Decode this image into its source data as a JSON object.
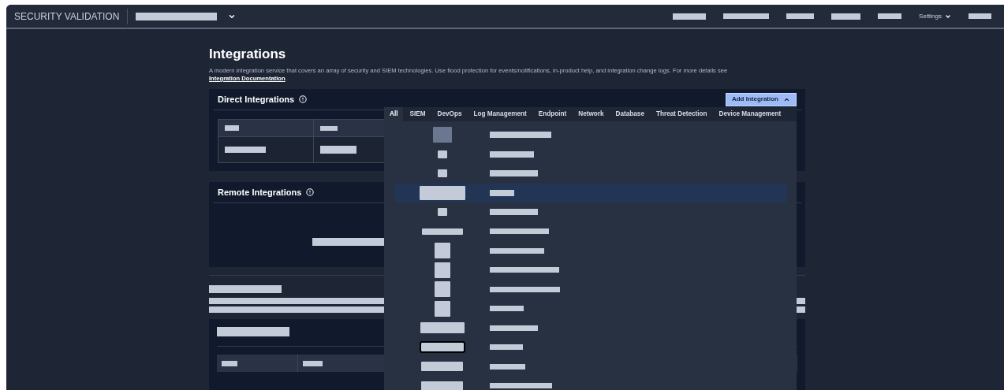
{
  "header": {
    "product": "SECURITY VALIDATION",
    "settings": "Settings"
  },
  "page": {
    "title": "Integrations",
    "description": "A modern integration service that covers an array of security and SIEM technologies. Use flood protection for events/notifications, in-product help, and integration change logs. For more details see ",
    "link": "Integration Documentation",
    "after_link": "."
  },
  "direct": {
    "title": "Direct Integrations"
  },
  "add_button": {
    "label": "Add Integration",
    "expanded": true
  },
  "remote": {
    "title": "Remote Integrations"
  },
  "tabs": [
    {
      "label": "All",
      "selected": true
    },
    {
      "label": "SIEM",
      "selected": false
    },
    {
      "label": "DevOps",
      "selected": false
    },
    {
      "label": "Log Management",
      "selected": false
    },
    {
      "label": "Endpoint",
      "selected": false
    },
    {
      "label": "Network",
      "selected": false
    },
    {
      "label": "Database",
      "selected": false
    },
    {
      "label": "Threat Detection",
      "selected": false
    },
    {
      "label": "Device Management",
      "selected": false
    }
  ],
  "options": [
    {
      "selected": false
    },
    {
      "selected": false
    },
    {
      "selected": false
    },
    {
      "selected": true
    },
    {
      "selected": false
    },
    {
      "selected": false
    },
    {
      "selected": false
    },
    {
      "selected": false
    },
    {
      "selected": false
    },
    {
      "selected": false
    },
    {
      "selected": false
    },
    {
      "selected": false
    },
    {
      "selected": false
    },
    {
      "selected": false
    }
  ]
}
